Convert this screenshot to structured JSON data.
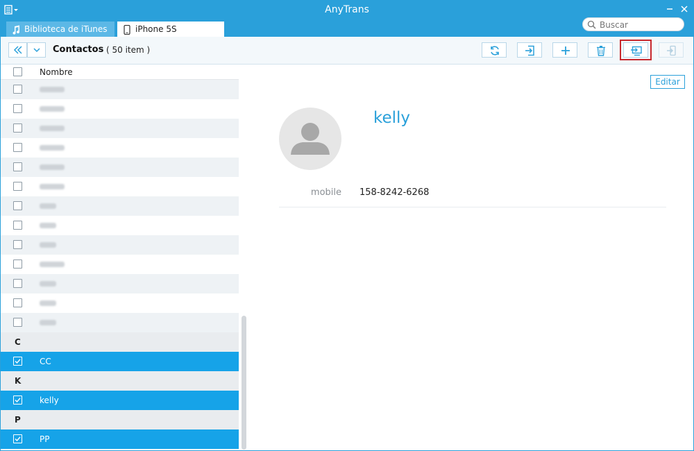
{
  "app": {
    "title": "AnyTrans"
  },
  "tabs": [
    {
      "label": "Biblioteca de iTunes"
    },
    {
      "label": "iPhone 5S"
    }
  ],
  "search": {
    "placeholder": "Buscar"
  },
  "toolbar": {
    "section_title": "Contactos",
    "item_count": "( 50 item )",
    "buttons": [
      "refresh-icon",
      "import-icon",
      "add-icon",
      "trash-icon",
      "to-computer-icon",
      "to-device-icon"
    ]
  },
  "list": {
    "header_label": "Nombre",
    "rows": [
      {
        "type": "contact",
        "label": "",
        "blurred": true
      },
      {
        "type": "contact",
        "label": "",
        "blurred": true
      },
      {
        "type": "contact",
        "label": "",
        "blurred": true
      },
      {
        "type": "contact",
        "label": "",
        "blurred": true
      },
      {
        "type": "contact",
        "label": "",
        "blurred": true
      },
      {
        "type": "contact",
        "label": "",
        "blurred": true
      },
      {
        "type": "contact",
        "label": "",
        "blurred": true
      },
      {
        "type": "contact",
        "label": "",
        "blurred": true
      },
      {
        "type": "contact",
        "label": "",
        "blurred": true
      },
      {
        "type": "contact",
        "label": "",
        "blurred": true
      },
      {
        "type": "contact",
        "label": "",
        "blurred": true
      },
      {
        "type": "contact",
        "label": "",
        "blurred": true
      },
      {
        "type": "contact",
        "label": "",
        "blurred": true
      },
      {
        "type": "group",
        "label": "C"
      },
      {
        "type": "contact",
        "label": "CC",
        "selected": true
      },
      {
        "type": "group",
        "label": "K"
      },
      {
        "type": "contact",
        "label": "kelly",
        "selected": true
      },
      {
        "type": "group",
        "label": "P"
      },
      {
        "type": "contact",
        "label": "PP",
        "selected": true
      }
    ]
  },
  "detail": {
    "edit_label": "Editar",
    "name": "kelly",
    "fields": [
      {
        "label": "mobile",
        "value": "158-8242-6268"
      }
    ]
  },
  "colors": {
    "accent": "#2aa0da",
    "selected_row": "#16a3e8",
    "highlight": "#c8282d"
  }
}
